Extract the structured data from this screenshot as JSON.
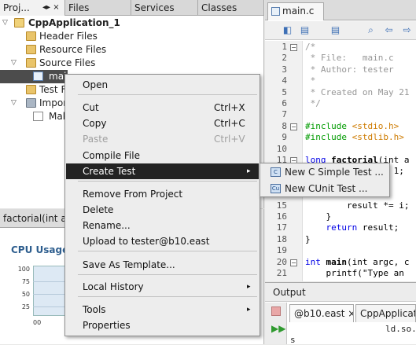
{
  "left_panel": {
    "tabs": [
      {
        "label": "Proj...",
        "close": "◂▸ ×"
      },
      {
        "label": "Files"
      },
      {
        "label": "Services"
      },
      {
        "label": "Classes"
      }
    ],
    "tree": [
      {
        "label": "CppApplication_1",
        "icon": "project-icon"
      },
      {
        "label": "Header Files",
        "icon": "folder-icon"
      },
      {
        "label": "Resource Files",
        "icon": "folder-icon"
      },
      {
        "label": "Source Files",
        "icon": "folder-icon"
      },
      {
        "label": "mai",
        "icon": "c-file-icon"
      },
      {
        "label": "Test F",
        "icon": "folder-icon"
      },
      {
        "label": "Impor",
        "icon": "folder-icon"
      },
      {
        "label": "Mak",
        "icon": "makefile-icon"
      }
    ]
  },
  "navigator": {
    "tab_label": "factorial(int ar",
    "chart_title": "CPU Usage",
    "y_ticks": [
      "100",
      "75",
      "50",
      "25"
    ],
    "x_tick": "00"
  },
  "editor": {
    "tab_label": "main.c",
    "tab_close": "×",
    "lines": [
      {
        "n": "1",
        "text": "/*"
      },
      {
        "n": "2",
        "text": " * File:   main.c"
      },
      {
        "n": "3",
        "text": " * Author: tester"
      },
      {
        "n": "4",
        "text": " *"
      },
      {
        "n": "5",
        "text": " * Created on May 21"
      },
      {
        "n": "6",
        "text": " */"
      },
      {
        "n": "7",
        "text": ""
      },
      {
        "n": "8",
        "text_pre": "#include ",
        "text_str": "<stdio.h>"
      },
      {
        "n": "9",
        "text_pre": "#include ",
        "text_str": "<stdlib.h>"
      },
      {
        "n": "10",
        "text": ""
      },
      {
        "n": "11",
        "kw": "long ",
        "fn": "factorial",
        "rest": "(int a"
      },
      {
        "n": "12",
        "text": "    int result = 1;"
      },
      {
        "n": "13",
        "text": ""
      },
      {
        "n": "14",
        "text": "         <="
      },
      {
        "n": "15",
        "text": "        result *= i;"
      },
      {
        "n": "16",
        "text": "    }"
      },
      {
        "n": "17",
        "kw": "    return ",
        "rest": "result;"
      },
      {
        "n": "18",
        "text": "}"
      },
      {
        "n": "19",
        "text": ""
      },
      {
        "n": "20",
        "kw": "int ",
        "fn": "main",
        "rest": "(int argc, c"
      },
      {
        "n": "21",
        "text": "    printf(\"Type an"
      }
    ]
  },
  "output": {
    "title": "Output",
    "tabs": [
      "@b10.east ×",
      "CppApplicati"
    ],
    "line1": "ld.so.",
    "line2": "s"
  },
  "context_menu": {
    "items": [
      {
        "label": "Open"
      },
      {
        "label": "Cut",
        "shortcut": "Ctrl+X"
      },
      {
        "label": "Copy",
        "shortcut": "Ctrl+C"
      },
      {
        "label": "Paste",
        "shortcut": "Ctrl+V",
        "disabled": true
      },
      {
        "label": "Compile File"
      },
      {
        "label": "Create Test",
        "submenu": true,
        "highlighted": true
      },
      {
        "label": "Remove From Project"
      },
      {
        "label": "Delete"
      },
      {
        "label": "Rename..."
      },
      {
        "label": "Upload to tester@b10.east"
      },
      {
        "label": "Save As Template..."
      },
      {
        "label": "Local History",
        "submenu": true
      },
      {
        "label": "Tools",
        "submenu": true
      },
      {
        "label": "Properties"
      }
    ],
    "arrow": "▸"
  },
  "submenu": {
    "items": [
      {
        "label": "New C Simple Test ...",
        "icon": "c-test-icon",
        "glyph": "C"
      },
      {
        "label": "New CUnit Test ...",
        "icon": "cunit-test-icon",
        "glyph": "Cu"
      }
    ]
  },
  "colors": {
    "menu_highlight": "#232323",
    "keyword": "#0000e6",
    "preprocessor": "#009b00",
    "string": "#ce7b00",
    "comment": "#969696"
  }
}
